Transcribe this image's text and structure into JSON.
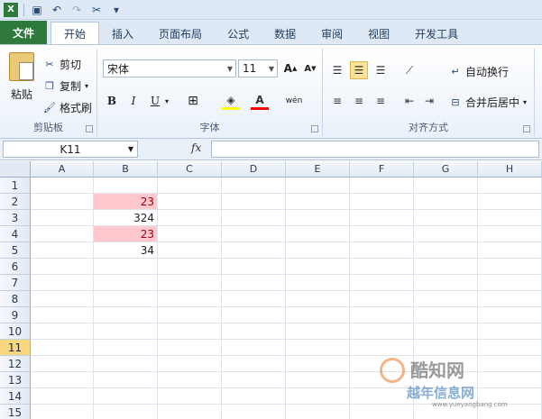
{
  "quick_access": {
    "icons": [
      "save-icon",
      "undo-icon",
      "redo-icon",
      "customize-icon"
    ]
  },
  "tabs": [
    "文件",
    "开始",
    "插入",
    "页面布局",
    "公式",
    "数据",
    "审阅",
    "视图",
    "开发工具"
  ],
  "clipboard": {
    "paste": "粘贴",
    "cut": "剪切",
    "copy": "复制",
    "format_painter": "格式刷",
    "group_label": "剪贴板"
  },
  "font": {
    "name": "宋体",
    "size": "11",
    "bold": "B",
    "italic": "I",
    "underline": "U",
    "group_label": "字体"
  },
  "alignment": {
    "wrap_text": "自动换行",
    "merge_center": "合并后居中",
    "group_label": "对齐方式"
  },
  "formula_bar": {
    "name_box": "K11",
    "fx": "fx",
    "formula": ""
  },
  "sheet": {
    "columns": [
      "A",
      "B",
      "C",
      "D",
      "E",
      "F",
      "G",
      "H"
    ],
    "rows": [
      "1",
      "2",
      "3",
      "4",
      "5",
      "6",
      "7",
      "8",
      "9",
      "10",
      "11",
      "12",
      "13",
      "14",
      "15"
    ],
    "selected_row": "11",
    "b_values": {
      "B2": "23",
      "B3": "324",
      "B4": "23",
      "B5": "34"
    },
    "highlight_color": "#ffc7ce",
    "highlight_text_color": "#9c0006"
  },
  "watermark": {
    "line1": "酷知网",
    "line2": "越年信息网",
    "line3": "www.yueyangbang.com"
  }
}
